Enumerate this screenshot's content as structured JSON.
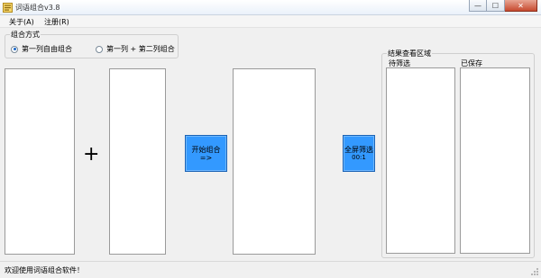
{
  "window": {
    "title": "词语组合v3.8",
    "close_label": "✕",
    "minimize_label": "—",
    "maximize_label": "☐"
  },
  "menu": {
    "about": "关于(A)",
    "register": "注册(R)"
  },
  "combine_mode": {
    "title": "组合方式",
    "option1": "第一列自由组合",
    "option2": "第一列 + 第二列组合",
    "selected": "option1"
  },
  "main": {
    "plus_sign": "+",
    "start_button": "开始组合=>",
    "filter_button": {
      "line1": "全屏筛选",
      "line2": "00:1"
    }
  },
  "results": {
    "title": "结果查看区域",
    "pending_label": "待筛选",
    "saved_label": "已保存"
  },
  "status": {
    "text": "欢迎使用词语组合软件！"
  },
  "colors": {
    "accent_button": "#3399ff"
  }
}
